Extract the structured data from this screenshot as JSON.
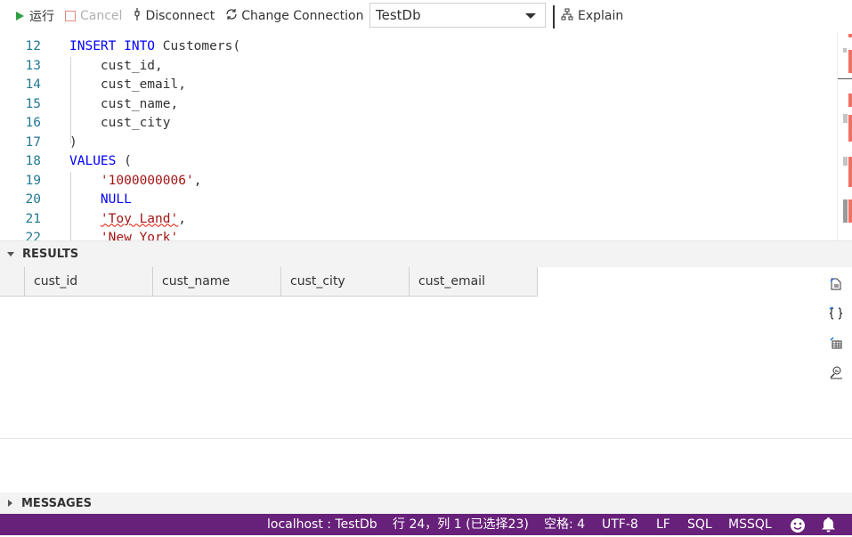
{
  "toolbar": {
    "run_label": "运行",
    "cancel_label": "Cancel",
    "disconnect_label": "Disconnect",
    "change_connection_label": "Change Connection",
    "database_selected": "TestDb",
    "explain_label": "Explain"
  },
  "editor": {
    "lines": [
      {
        "num": "12",
        "tokens": [
          {
            "t": "kw",
            "v": "INSERT INTO"
          },
          {
            "t": "plain",
            "v": " Customers("
          }
        ]
      },
      {
        "num": "13",
        "tokens": [
          {
            "t": "plain",
            "v": "    cust_id,"
          }
        ]
      },
      {
        "num": "14",
        "tokens": [
          {
            "t": "plain",
            "v": "    cust_email,"
          }
        ]
      },
      {
        "num": "15",
        "tokens": [
          {
            "t": "plain",
            "v": "    cust_name,"
          }
        ]
      },
      {
        "num": "16",
        "tokens": [
          {
            "t": "plain",
            "v": "    cust_city"
          }
        ]
      },
      {
        "num": "17",
        "tokens": [
          {
            "t": "plain",
            "v": ")"
          }
        ]
      },
      {
        "num": "18",
        "tokens": [
          {
            "t": "kw",
            "v": "VALUES"
          },
          {
            "t": "plain",
            "v": " ("
          }
        ]
      },
      {
        "num": "19",
        "tokens": [
          {
            "t": "plain",
            "v": "    "
          },
          {
            "t": "str",
            "v": "'1000000006'"
          },
          {
            "t": "plain",
            "v": ","
          }
        ]
      },
      {
        "num": "20",
        "tokens": [
          {
            "t": "plain",
            "v": "    "
          },
          {
            "t": "kw",
            "v": "NULL"
          }
        ]
      },
      {
        "num": "21",
        "tokens": [
          {
            "t": "plain",
            "v": "    "
          },
          {
            "t": "strsq",
            "v": "'Toy Land'"
          },
          {
            "t": "plain",
            "v": ","
          }
        ]
      },
      {
        "num": "22",
        "tokens": [
          {
            "t": "plain",
            "v": "    "
          },
          {
            "t": "strsq",
            "v": "'New York'"
          }
        ]
      }
    ]
  },
  "results": {
    "header": "RESULTS",
    "columns": [
      "cust_id",
      "cust_name",
      "cust_city",
      "cust_email"
    ]
  },
  "messages": {
    "header": "MESSAGES"
  },
  "status": {
    "connection": "localhost : TestDb",
    "position": "行 24，列 1 (已选择23)",
    "spaces": "空格: 4",
    "encoding": "UTF-8",
    "eol": "LF",
    "language": "SQL",
    "provider": "MSSQL"
  },
  "colors": {
    "status_bar": "#68217a",
    "keyword": "#0000ff",
    "string": "#a31515",
    "line_number": "#237893",
    "run_icon": "#2ea043"
  }
}
